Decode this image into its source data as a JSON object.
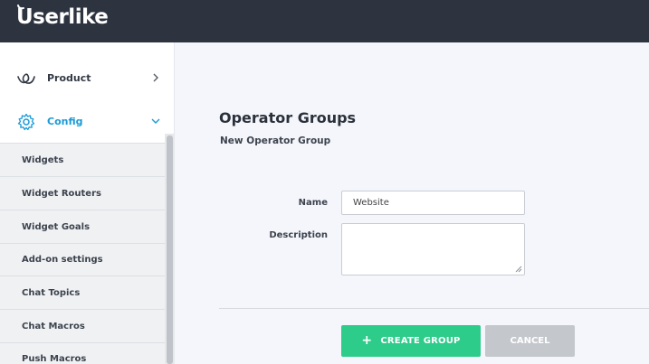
{
  "brand": {
    "name": "Userlike"
  },
  "sidebar": {
    "main_items": [
      {
        "label": "Product",
        "icon": "product-swirl-icon",
        "expanded": false
      },
      {
        "label": "Config",
        "icon": "gear-icon",
        "expanded": true
      }
    ],
    "sub_items": [
      {
        "label": "Widgets"
      },
      {
        "label": "Widget Routers"
      },
      {
        "label": "Widget Goals"
      },
      {
        "label": "Add-on settings"
      },
      {
        "label": "Chat Topics"
      },
      {
        "label": "Chat Macros"
      },
      {
        "label": "Push Macros"
      }
    ]
  },
  "main": {
    "title": "Operator Groups",
    "subtitle": "New Operator Group",
    "form": {
      "name_label": "Name",
      "name_value": "Website",
      "description_label": "Description",
      "description_value": ""
    },
    "buttons": {
      "create_icon": "+",
      "create_label": "CREATE GROUP",
      "cancel_label": "CANCEL"
    }
  },
  "colors": {
    "topbar": "#2d333f",
    "accent": "#1a9ad6",
    "create_button": "#2ecc8a",
    "cancel_button": "#c4c7cc",
    "main_background": "#f4f6fb"
  }
}
